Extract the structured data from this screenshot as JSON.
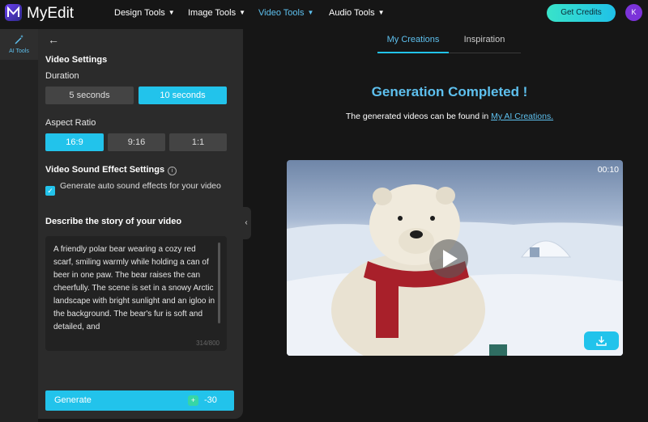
{
  "app": {
    "name": "MyEdit"
  },
  "nav": {
    "items": [
      {
        "label": "Design Tools"
      },
      {
        "label": "Image Tools"
      },
      {
        "label": "Video Tools"
      },
      {
        "label": "Audio Tools"
      }
    ],
    "active": "Video Tools",
    "credits_button": "Get Credits",
    "avatar_initial": "K"
  },
  "rail": {
    "items": [
      {
        "label": "AI Tools",
        "icon": "magic-wand-icon"
      }
    ]
  },
  "settings": {
    "heading": "Video Settings",
    "duration": {
      "label": "Duration",
      "options": [
        "5 seconds",
        "10 seconds"
      ],
      "selected": "10 seconds"
    },
    "aspect_ratio": {
      "label": "Aspect Ratio",
      "options": [
        "16:9",
        "9:16",
        "1:1"
      ],
      "selected": "16:9"
    },
    "sound": {
      "heading": "Video Sound Effect Settings",
      "checkbox_label": "Generate auto sound effects for your video",
      "checked": true
    },
    "story": {
      "heading": "Describe the story of your video",
      "text": "A friendly polar bear wearing a cozy red scarf, smiling warmly while holding a can of beer in one paw. The bear raises the can cheerfully. The scene is set in a snowy Arctic landscape with bright sunlight and an igloo in the background. The bear's fur is soft and detailed, and",
      "char_count": "314/800"
    },
    "generate": {
      "label": "Generate",
      "cost": "-30"
    }
  },
  "main": {
    "tabs": [
      {
        "label": "My Creations"
      },
      {
        "label": "Inspiration"
      }
    ],
    "active_tab": "My Creations",
    "headline": "Generation Completed !",
    "subline_prefix": "The generated videos can be found in",
    "subline_link": "My AI Creations.",
    "video": {
      "duration": "00:10"
    }
  },
  "colors": {
    "accent": "#22c3eb",
    "accent_text": "#5ec0ee",
    "panel": "#2b2b2b",
    "background": "#161616"
  }
}
